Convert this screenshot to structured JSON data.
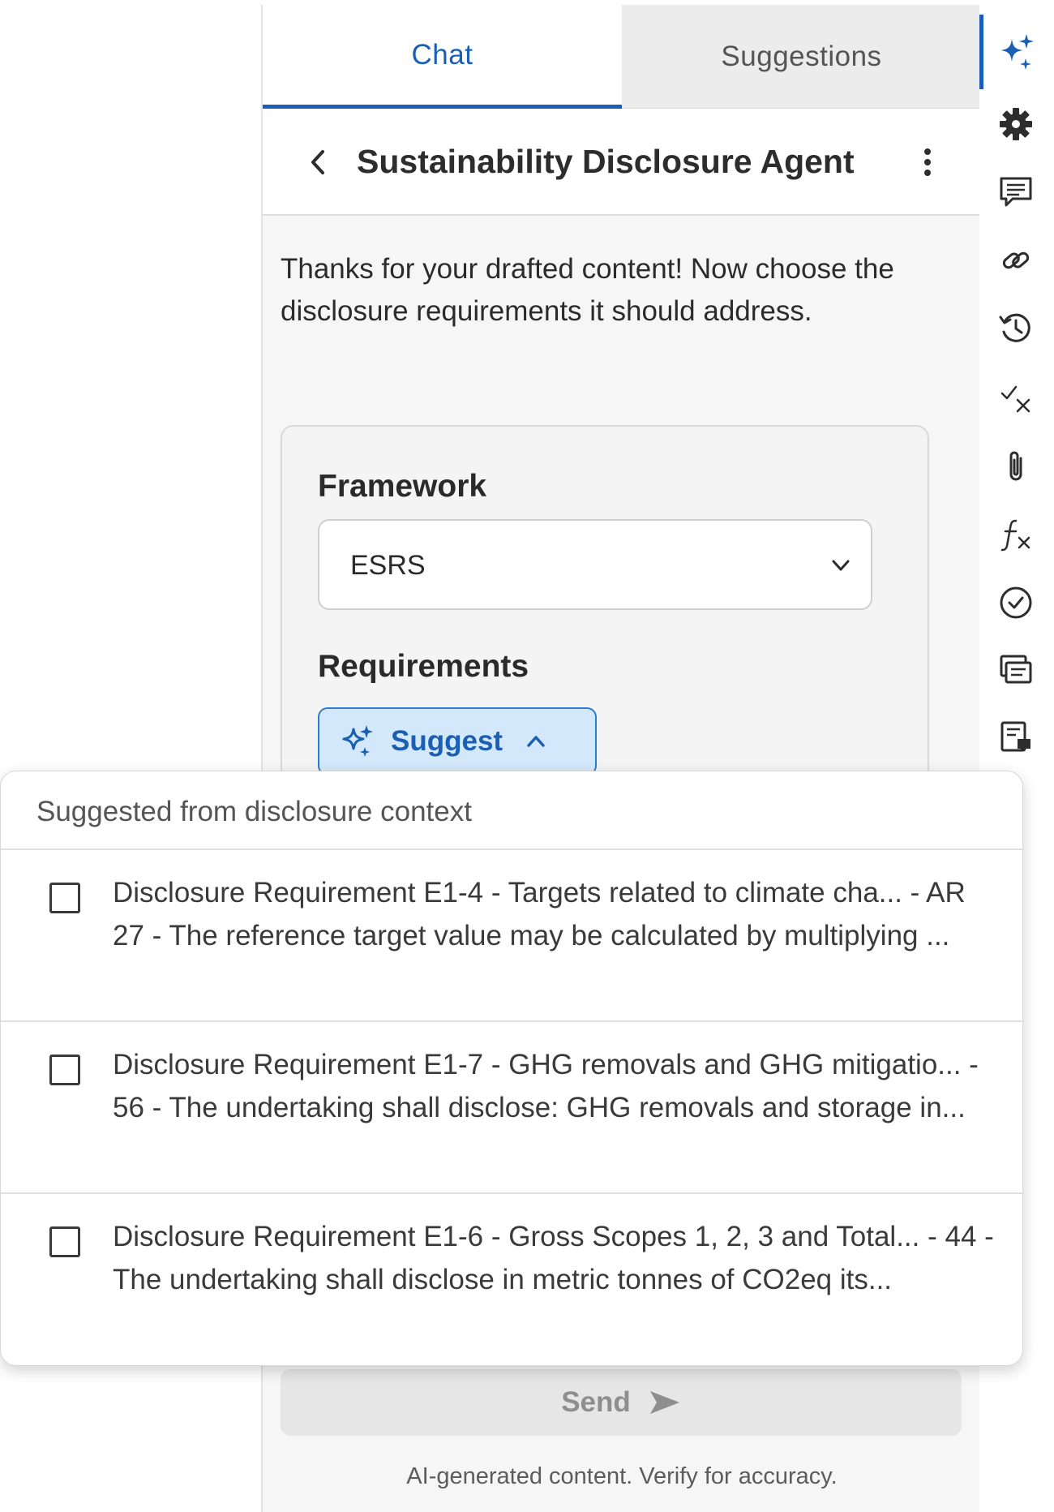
{
  "tabs": [
    {
      "label": "Chat",
      "active": true
    },
    {
      "label": "Suggestions",
      "active": false
    }
  ],
  "header": {
    "title": "Sustainability Disclosure Agent",
    "back_icon": "chevron-left-icon",
    "more_icon": "more-vertical-icon"
  },
  "message": {
    "text": "Thanks for your drafted content! Now choose the disclosure requirements it should address."
  },
  "form": {
    "framework_label": "Framework",
    "framework_value": "ESRS",
    "requirements_label": "Requirements",
    "suggest_label": "Suggest"
  },
  "dropdown": {
    "heading": "Suggested from disclosure context",
    "items": [
      {
        "text": "Disclosure Requirement E1-4 - Targets related to climate cha... - AR 27 - The reference target value may be calculated by multiplying ...",
        "checked": false
      },
      {
        "text": "Disclosure Requirement E1-7 - GHG removals and GHG mitigatio... - 56 - The undertaking shall disclose: GHG removals and storage in...",
        "checked": false
      },
      {
        "text": "Disclosure Requirement E1-6 - Gross Scopes 1, 2, 3 and Total... - 44 - The undertaking shall disclose in metric tonnes of CO2eq its...",
        "checked": false
      }
    ]
  },
  "footer": {
    "send_label": "Send",
    "disclaimer": "AI-generated content. Verify for accuracy."
  },
  "rail": {
    "icons": [
      "sparkle-icon",
      "gear-icon",
      "comment-icon",
      "link-icon",
      "history-icon",
      "check-cross-icon",
      "paperclip-icon",
      "formula-icon",
      "check-circle-icon",
      "list-icon",
      "document-comment-icon"
    ]
  },
  "colors": {
    "accent": "#1a5fb4",
    "suggest_bg": "#d3e9fb",
    "panel_bg": "#f6f6f6"
  }
}
